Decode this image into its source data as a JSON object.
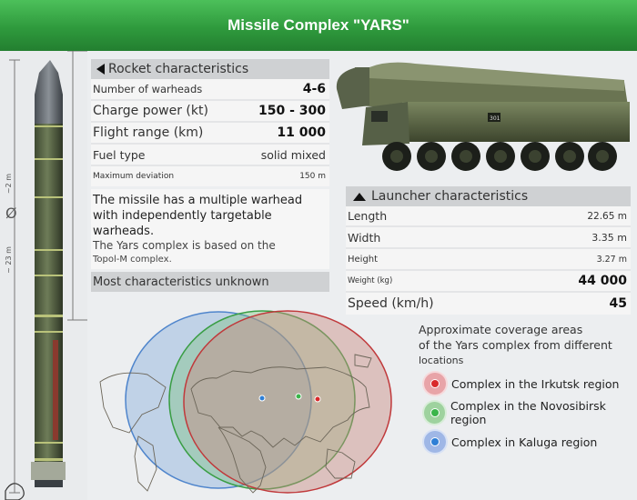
{
  "header": {
    "title": "Missile Complex \"YARS\""
  },
  "rocket": {
    "dimension_total": "~ 23 m",
    "dimension_diameter": "~2 m",
    "diameter_symbol": "Ø"
  },
  "rocket_characteristics": {
    "title": "Rocket characteristics",
    "rows": [
      {
        "label": "Number of warheads",
        "value": "4-6"
      },
      {
        "label": "Charge power (kt)",
        "value": "150 - 300"
      },
      {
        "label": "Flight range (km)",
        "value": "11 000"
      },
      {
        "label": "Fuel type",
        "value": "solid mixed"
      },
      {
        "label": "Maximum deviation",
        "value": "150 m"
      }
    ]
  },
  "info": {
    "text1": "The missile has a multiple warhead with independently targetable warheads.",
    "text2": "The Yars complex is based on the",
    "text3": "Topol-M complex.",
    "unknown": "Most characteristics unknown"
  },
  "launcher": {
    "number": "301"
  },
  "launcher_characteristics": {
    "title": "Launcher characteristics",
    "rows": [
      {
        "label": "Length",
        "value": "22.65 m"
      },
      {
        "label": "Width",
        "value": "3.35 m"
      },
      {
        "label": "Height",
        "value": "3.27 m"
      },
      {
        "label": "Weight (kg)",
        "value": "44 000"
      },
      {
        "label": "Speed (km/h)",
        "value": "45"
      }
    ]
  },
  "coverage": {
    "title_line1": "Approximate coverage areas",
    "title_line2": "of the Yars complex from different",
    "title_line3": "locations",
    "items": [
      {
        "label": "Complex in the Irkutsk region",
        "color": "#d9292a",
        "ring": "#e8a4a8"
      },
      {
        "label": "Complex in the Novosibirsk region",
        "color": "#3ab54a",
        "ring": "#9ed29e"
      },
      {
        "label": "Complex in Kaluga region",
        "color": "#2e7fd6",
        "ring": "#9fb7e6"
      }
    ]
  }
}
